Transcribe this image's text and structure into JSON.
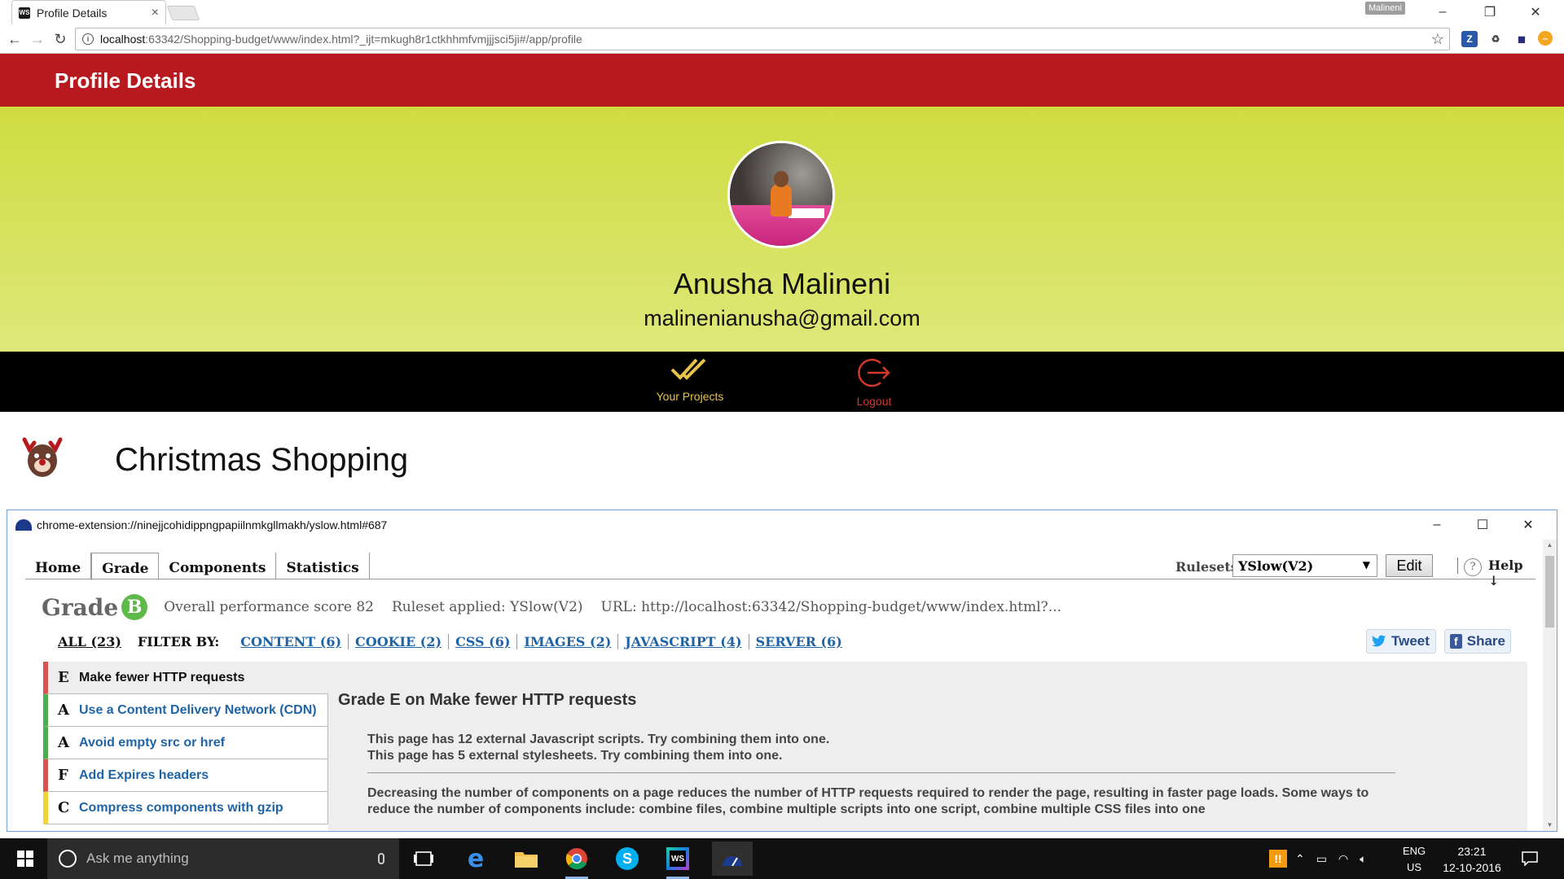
{
  "browser": {
    "tab_title": "Profile Details",
    "tab_favicon": "WS",
    "profile_badge": "Malineni",
    "url_host": "localhost",
    "url_rest": ":63342/Shopping-budget/www/index.html?_ijt=mkugh8r1ctkhhmfvmjjjsci5ji#/app/profile",
    "extensions": [
      "Z",
      "♻",
      "◼",
      "–"
    ]
  },
  "app": {
    "header_title": "Profile Details",
    "user_name": "Anusha Malineni",
    "user_email": "malinenianusha@gmail.com",
    "actions": [
      {
        "label": "Your Projects",
        "icon": "double-check-icon"
      },
      {
        "label": "Logout",
        "icon": "logout-icon"
      }
    ],
    "project_title": "Christmas Shopping"
  },
  "yslow": {
    "window_title": "chrome-extension://ninejjcohidippngpapiilnmkgllmakh/yslow.html#687",
    "tabs": [
      "Home",
      "Grade",
      "Components",
      "Statistics"
    ],
    "active_tab": "Grade",
    "rulesets_label": "Rulesets",
    "ruleset_value": "YSlow(V2)",
    "edit_label": "Edit",
    "help_q": "?",
    "help_label": "Help ↓",
    "grade_word": "Grade",
    "grade_letter": "B",
    "score_text": "Overall performance score 82",
    "ruleset_text": "Ruleset applied: YSlow(V2)",
    "url_text": "URL: http://localhost:63342/Shopping-budget/www/index.html?...",
    "filter_all": "ALL (23)",
    "filter_by": "FILTER BY:",
    "filters": [
      "CONTENT (6)",
      "COOKIE (2)",
      "CSS (6)",
      "IMAGES (2)",
      "JAVASCRIPT (4)",
      "SERVER (6)"
    ],
    "tweet_label": "Tweet",
    "share_label": "Share",
    "rules": [
      {
        "grade": "E",
        "title": "Make fewer HTTP requests"
      },
      {
        "grade": "A",
        "title": "Use a Content Delivery Network (CDN)"
      },
      {
        "grade": "A",
        "title": "Avoid empty src or href"
      },
      {
        "grade": "F",
        "title": "Add Expires headers"
      },
      {
        "grade": "C",
        "title": "Compress components with gzip"
      }
    ],
    "detail_title": "Grade E on Make fewer HTTP requests",
    "detail_msg1": "This page has 12 external Javascript scripts. Try combining them into one.",
    "detail_msg2": "This page has 5 external stylesheets. Try combining them into one.",
    "detail_desc": "Decreasing the number of components on a page reduces the number of HTTP requests required to render the page, resulting in faster page loads. Some ways to reduce the number of components include: combine files, combine multiple scripts into one script, combine multiple CSS files into one"
  },
  "taskbar": {
    "search_placeholder": "Ask me anything",
    "lang_line1": "ENG",
    "lang_line2": "US",
    "time": "23:21",
    "date": "12-10-2016"
  },
  "colors": {
    "header_red": "#b7191f",
    "profile_green": "#cfdc3f",
    "grade_b": "#5eb84a",
    "link_blue": "#1e64a7"
  }
}
